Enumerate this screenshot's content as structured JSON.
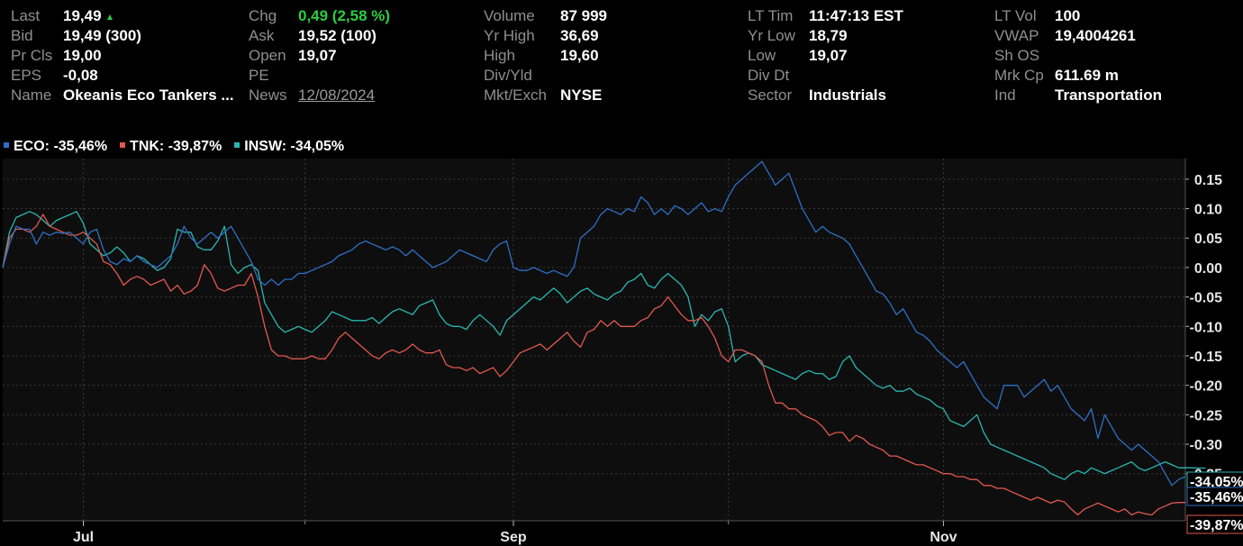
{
  "quote": {
    "rows": [
      [
        {
          "label": "Last",
          "value": "19,49",
          "marker": "up-triangle-icon"
        },
        {
          "label": "Chg",
          "value": "0,49 (2,58 %)",
          "tone": "up"
        },
        {
          "label": "Volume",
          "value": "87 999"
        },
        {
          "label": "LT Tim",
          "value": "11:47:13 EST"
        },
        {
          "label": "LT Vol",
          "value": "100"
        }
      ],
      [
        {
          "label": "Bid",
          "value": "19,49 (300)"
        },
        {
          "label": "Ask",
          "value": "19,52 (100)"
        },
        {
          "label": "Yr High",
          "value": "36,69"
        },
        {
          "label": "Yr Low",
          "value": "18,79"
        },
        {
          "label": "VWAP",
          "value": "19,4004261"
        }
      ],
      [
        {
          "label": "Pr Cls",
          "value": "19,00"
        },
        {
          "label": "Open",
          "value": "19,07"
        },
        {
          "label": "High",
          "value": "19,60"
        },
        {
          "label": "Low",
          "value": "19,07"
        },
        {
          "label": "Sh OS",
          "value": ""
        }
      ],
      [
        {
          "label": "EPS",
          "value": "-0,08"
        },
        {
          "label": "PE",
          "value": ""
        },
        {
          "label": "Div/Yld",
          "value": ""
        },
        {
          "label": "Div Dt",
          "value": ""
        },
        {
          "label": "Mrk Cp",
          "value": "611.69 m"
        }
      ],
      [
        {
          "label": "Name",
          "value": "Okeanis Eco Tankers ..."
        },
        {
          "label": "News",
          "value": "12/08/2024",
          "tone": "link"
        },
        {
          "label": "Mkt/Exch",
          "value": "NYSE"
        },
        {
          "label": "Sector",
          "value": "Industrials"
        },
        {
          "label": "Ind",
          "value": "Transportation"
        }
      ]
    ]
  },
  "chart_data": {
    "type": "line",
    "title": "",
    "xlabel": "",
    "ylabel": "",
    "ylim": [
      -0.43,
      0.185
    ],
    "y_ticks": [
      "0.15",
      "0.10",
      "0.05",
      "0.00",
      "-0.05",
      "-0.10",
      "-0.15",
      "-0.20",
      "-0.25",
      "-0.30",
      "-0.35"
    ],
    "x_tick_labels": [
      "Jul",
      "Sep",
      "Nov"
    ],
    "x_tick_index": [
      12,
      76,
      140
    ],
    "x_minor_tick_index": [
      45,
      108
    ],
    "grid": true,
    "background": "#0e0e0e",
    "grid_color": "#3a3a3a",
    "series": [
      {
        "name": "ECO",
        "legend_text": "ECO: -35,46%",
        "end_label": "-35,46%",
        "color": "#2f6fc4",
        "values": [
          0.0,
          0.04,
          0.07,
          0.065,
          0.065,
          0.04,
          0.06,
          0.055,
          0.06,
          0.058,
          0.06,
          0.05,
          0.04,
          0.06,
          0.065,
          0.03,
          0.01,
          0.005,
          0.015,
          0.01,
          0.02,
          0.01,
          0.005,
          0.0,
          0.01,
          0.02,
          0.04,
          0.07,
          0.05,
          0.04,
          0.05,
          0.06,
          0.05,
          0.06,
          0.07,
          0.05,
          0.03,
          0.01,
          -0.02,
          -0.03,
          -0.02,
          -0.03,
          -0.02,
          -0.02,
          -0.01,
          -0.01,
          -0.005,
          0.0,
          0.005,
          0.01,
          0.02,
          0.025,
          0.03,
          0.04,
          0.045,
          0.04,
          0.035,
          0.03,
          0.035,
          0.03,
          0.02,
          0.03,
          0.02,
          0.01,
          0.0,
          0.005,
          0.01,
          0.02,
          0.03,
          0.025,
          0.02,
          0.015,
          0.01,
          0.03,
          0.04,
          0.045,
          0.0,
          -0.005,
          -0.005,
          0.0,
          -0.005,
          -0.01,
          -0.005,
          -0.01,
          -0.015,
          0.0,
          0.05,
          0.06,
          0.07,
          0.09,
          0.1,
          0.095,
          0.09,
          0.1,
          0.095,
          0.12,
          0.11,
          0.09,
          0.1,
          0.09,
          0.105,
          0.1,
          0.09,
          0.1,
          0.11,
          0.095,
          0.1,
          0.095,
          0.12,
          0.14,
          0.15,
          0.16,
          0.17,
          0.18,
          0.16,
          0.14,
          0.15,
          0.16,
          0.13,
          0.1,
          0.08,
          0.06,
          0.07,
          0.06,
          0.055,
          0.05,
          0.04,
          0.02,
          0.0,
          -0.02,
          -0.04,
          -0.045,
          -0.06,
          -0.08,
          -0.07,
          -0.09,
          -0.11,
          -0.115,
          -0.125,
          -0.14,
          -0.15,
          -0.16,
          -0.17,
          -0.16,
          -0.18,
          -0.2,
          -0.22,
          -0.23,
          -0.24,
          -0.2,
          -0.2,
          -0.2,
          -0.22,
          -0.21,
          -0.2,
          -0.19,
          -0.21,
          -0.2,
          -0.22,
          -0.24,
          -0.25,
          -0.26,
          -0.24,
          -0.29,
          -0.25,
          -0.27,
          -0.29,
          -0.3,
          -0.31,
          -0.3,
          -0.31,
          -0.32,
          -0.33,
          -0.35,
          -0.37,
          -0.36,
          -0.355
        ]
      },
      {
        "name": "TNK",
        "legend_text": "TNK: -39,87%",
        "end_label": "-39,87%",
        "color": "#e0584e",
        "values": [
          0.0,
          0.05,
          0.065,
          0.065,
          0.06,
          0.07,
          0.09,
          0.07,
          0.065,
          0.06,
          0.055,
          0.055,
          0.06,
          0.05,
          0.04,
          0.01,
          0.005,
          -0.01,
          -0.03,
          -0.02,
          -0.015,
          -0.02,
          -0.03,
          -0.025,
          -0.02,
          -0.04,
          -0.03,
          -0.045,
          -0.04,
          -0.03,
          0.005,
          -0.01,
          -0.035,
          -0.04,
          -0.035,
          -0.03,
          -0.03,
          -0.01,
          -0.05,
          -0.1,
          -0.14,
          -0.15,
          -0.15,
          -0.155,
          -0.155,
          -0.155,
          -0.15,
          -0.155,
          -0.155,
          -0.14,
          -0.12,
          -0.11,
          -0.12,
          -0.13,
          -0.14,
          -0.15,
          -0.155,
          -0.145,
          -0.14,
          -0.145,
          -0.14,
          -0.13,
          -0.14,
          -0.145,
          -0.145,
          -0.14,
          -0.165,
          -0.17,
          -0.17,
          -0.175,
          -0.17,
          -0.18,
          -0.175,
          -0.17,
          -0.185,
          -0.175,
          -0.16,
          -0.145,
          -0.14,
          -0.135,
          -0.13,
          -0.14,
          -0.13,
          -0.12,
          -0.11,
          -0.125,
          -0.135,
          -0.11,
          -0.105,
          -0.09,
          -0.1,
          -0.09,
          -0.1,
          -0.1,
          -0.1,
          -0.09,
          -0.085,
          -0.07,
          -0.065,
          -0.05,
          -0.065,
          -0.08,
          -0.09,
          -0.09,
          -0.085,
          -0.1,
          -0.12,
          -0.15,
          -0.16,
          -0.14,
          -0.14,
          -0.145,
          -0.15,
          -0.16,
          -0.2,
          -0.23,
          -0.23,
          -0.24,
          -0.24,
          -0.25,
          -0.255,
          -0.26,
          -0.27,
          -0.285,
          -0.28,
          -0.28,
          -0.295,
          -0.285,
          -0.29,
          -0.3,
          -0.305,
          -0.31,
          -0.32,
          -0.32,
          -0.325,
          -0.33,
          -0.335,
          -0.335,
          -0.34,
          -0.345,
          -0.35,
          -0.35,
          -0.355,
          -0.355,
          -0.36,
          -0.36,
          -0.37,
          -0.37,
          -0.375,
          -0.375,
          -0.38,
          -0.385,
          -0.39,
          -0.395,
          -0.39,
          -0.395,
          -0.4,
          -0.395,
          -0.398,
          -0.41,
          -0.42,
          -0.41,
          -0.405,
          -0.4,
          -0.405,
          -0.41,
          -0.415,
          -0.41,
          -0.42,
          -0.415,
          -0.418,
          -0.42,
          -0.41,
          -0.405,
          -0.4,
          -0.399,
          -0.399
        ]
      },
      {
        "name": "INSW",
        "legend_text": "INSW: -34,05%",
        "end_label": "-34,05%",
        "color": "#2ab5b0",
        "values": [
          0.0,
          0.06,
          0.085,
          0.09,
          0.095,
          0.09,
          0.08,
          0.07,
          0.08,
          0.085,
          0.09,
          0.095,
          0.075,
          0.04,
          0.03,
          0.02,
          0.025,
          0.035,
          0.025,
          0.01,
          0.02,
          0.015,
          0.005,
          -0.005,
          0.0,
          0.015,
          0.065,
          0.06,
          0.06,
          0.035,
          0.03,
          0.03,
          0.045,
          0.07,
          0.005,
          -0.01,
          0.0,
          0.005,
          -0.005,
          -0.06,
          -0.08,
          -0.1,
          -0.11,
          -0.105,
          -0.1,
          -0.105,
          -0.11,
          -0.1,
          -0.09,
          -0.075,
          -0.08,
          -0.085,
          -0.09,
          -0.09,
          -0.09,
          -0.085,
          -0.095,
          -0.085,
          -0.075,
          -0.07,
          -0.075,
          -0.08,
          -0.065,
          -0.06,
          -0.055,
          -0.08,
          -0.095,
          -0.1,
          -0.1,
          -0.105,
          -0.09,
          -0.08,
          -0.09,
          -0.1,
          -0.115,
          -0.09,
          -0.08,
          -0.07,
          -0.06,
          -0.05,
          -0.055,
          -0.045,
          -0.035,
          -0.045,
          -0.06,
          -0.05,
          -0.04,
          -0.035,
          -0.045,
          -0.05,
          -0.055,
          -0.045,
          -0.04,
          -0.025,
          -0.02,
          -0.01,
          -0.03,
          -0.035,
          -0.02,
          -0.01,
          -0.02,
          -0.03,
          -0.05,
          -0.1,
          -0.08,
          -0.09,
          -0.075,
          -0.07,
          -0.1,
          -0.16,
          -0.15,
          -0.145,
          -0.15,
          -0.165,
          -0.17,
          -0.175,
          -0.18,
          -0.185,
          -0.19,
          -0.18,
          -0.175,
          -0.18,
          -0.18,
          -0.19,
          -0.185,
          -0.16,
          -0.15,
          -0.17,
          -0.18,
          -0.19,
          -0.2,
          -0.205,
          -0.2,
          -0.21,
          -0.21,
          -0.205,
          -0.215,
          -0.22,
          -0.225,
          -0.235,
          -0.24,
          -0.26,
          -0.265,
          -0.27,
          -0.26,
          -0.25,
          -0.28,
          -0.3,
          -0.305,
          -0.31,
          -0.315,
          -0.32,
          -0.325,
          -0.33,
          -0.335,
          -0.34,
          -0.35,
          -0.355,
          -0.36,
          -0.35,
          -0.345,
          -0.35,
          -0.34,
          -0.345,
          -0.35,
          -0.345,
          -0.34,
          -0.335,
          -0.33,
          -0.34,
          -0.345,
          -0.34,
          -0.335,
          -0.33,
          -0.335,
          -0.34,
          -0.34,
          -0.34,
          -0.3405,
          -0.3405
        ]
      }
    ]
  }
}
